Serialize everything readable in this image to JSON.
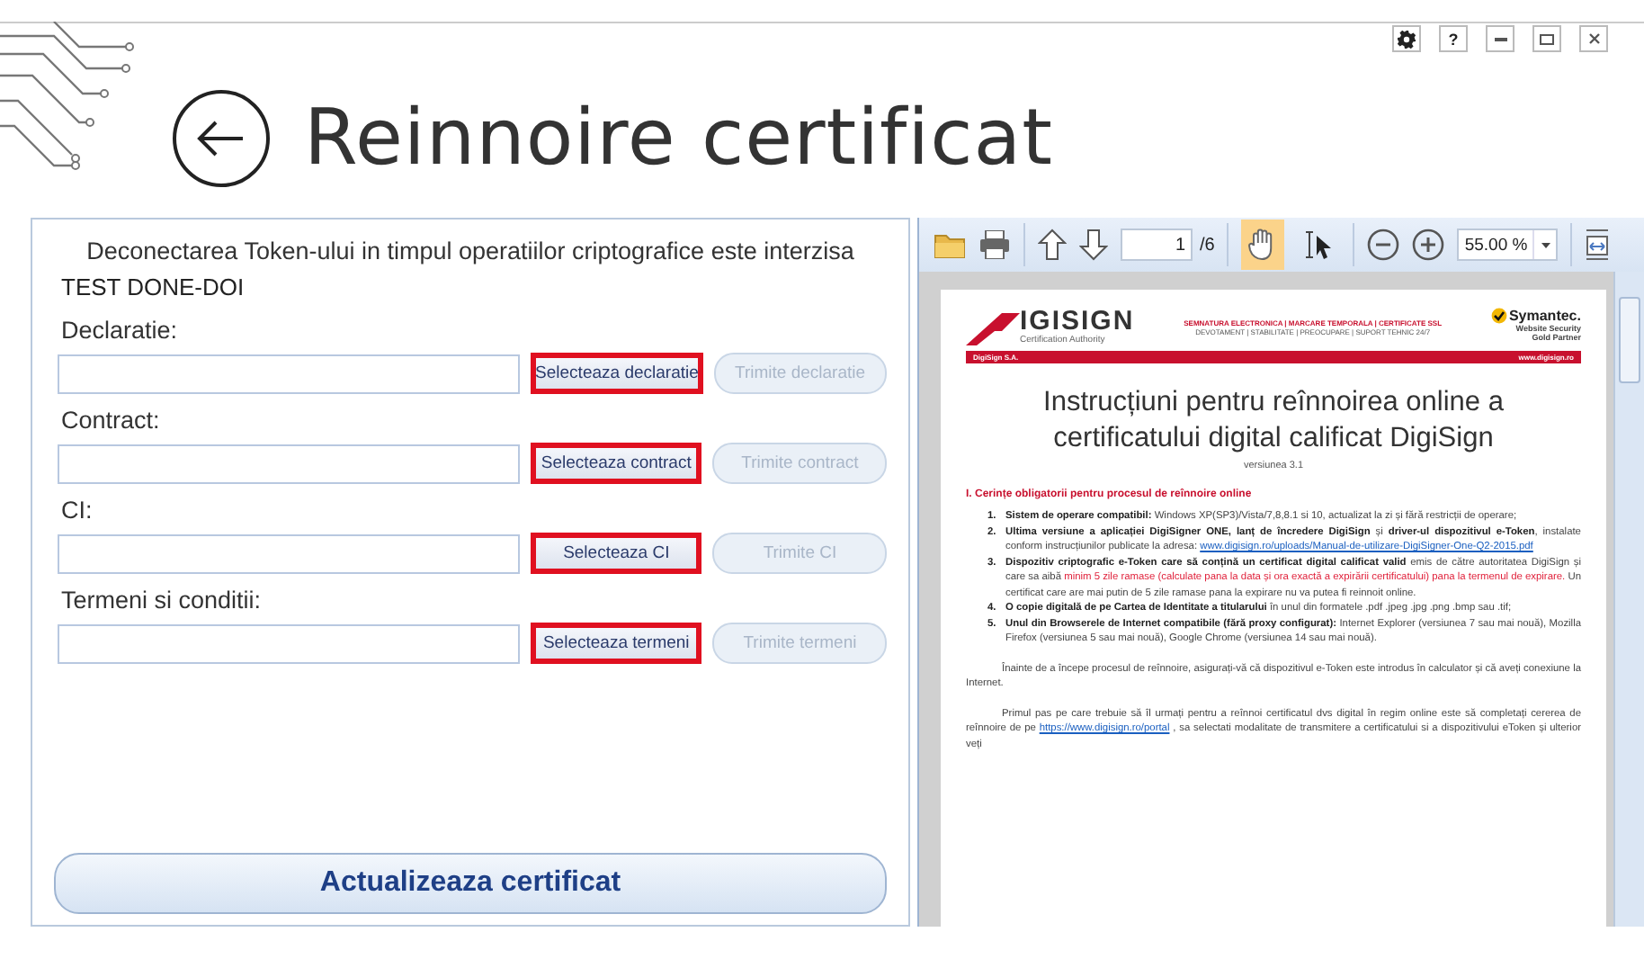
{
  "window": {
    "title": "Reinnoire certificat",
    "controls": [
      {
        "kind": "settings"
      },
      {
        "kind": "help",
        "label": "?"
      },
      {
        "kind": "minimize"
      },
      {
        "kind": "maximize"
      },
      {
        "kind": "close"
      }
    ]
  },
  "form": {
    "warning": "Deconectarea Token-ului in timpul operatiilor criptografice este interzisa",
    "user": "TEST DONE-DOI",
    "rows": [
      {
        "label": "Declaratie:",
        "select": "Selecteaza declaratie",
        "send": "Trimite declaratie",
        "highlighted": true,
        "send_disabled": true
      },
      {
        "label": "Contract:",
        "select": "Selecteaza contract",
        "send": "Trimite contract",
        "highlighted": true,
        "send_disabled": true
      },
      {
        "label": "CI:",
        "select": "Selecteaza CI",
        "send": "Trimite CI",
        "highlighted": true,
        "send_disabled": true
      },
      {
        "label": "Termeni si conditii:",
        "select": "Selecteaza termeni",
        "send": "Trimite termeni",
        "highlighted": true,
        "send_disabled": true
      }
    ],
    "submit": "Actualizeaza certificat"
  },
  "viewer": {
    "toolbar": [
      {
        "kind": "open"
      },
      {
        "kind": "print"
      },
      {
        "kind": "sep"
      },
      {
        "kind": "prev"
      },
      {
        "kind": "next"
      },
      {
        "kind": "page",
        "value": "1",
        "total": "/6"
      },
      {
        "kind": "sep"
      },
      {
        "kind": "hand",
        "selected": true
      },
      {
        "kind": "select",
        "selected": false
      },
      {
        "kind": "sep"
      },
      {
        "kind": "zoomout"
      },
      {
        "kind": "zoomin"
      },
      {
        "kind": "zoom",
        "value": "55.00 %"
      },
      {
        "kind": "sep"
      },
      {
        "kind": "fit"
      }
    ],
    "document": {
      "logo": "IGISIGN",
      "logo_sub": "Certification Authority",
      "tagline": "SEMNATURA ELECTRONICA | MARCARE TEMPORALA | CERTIFICATE SSL",
      "values": "DEVOTAMENT | STABILITATE | PREOCUPARE | SUPORT TEHNIC 24/7",
      "partner": "Symantec.",
      "partner_sub": [
        "Website Security",
        "Gold Partner"
      ],
      "bar_left": "DigiSign S.A.",
      "bar_right": "www.digisign.ro",
      "title": "Instrucțiuni pentru reînnoirea online a certificatului digital calificat DigiSign",
      "version": "versiunea 3.1",
      "heading": "I. Cerințe obligatorii pentru procesul de reînnoire online",
      "items": [
        {
          "number": "1.",
          "segments": [
            {
              "kind": "bold",
              "text": "Sistem de operare compatibil:"
            },
            {
              "kind": "plain",
              "text": " Windows XP(SP3)/Vista/7,8,8.1 si 10, actualizat la zi și fără restricții de operare;"
            }
          ]
        },
        {
          "number": "2.",
          "segments": [
            {
              "kind": "bold",
              "text": "Ultima versiune a aplicației DigiSigner ONE, lanț de încredere DigiSign"
            },
            {
              "kind": "plain",
              "text": " și "
            },
            {
              "kind": "bold",
              "text": "driver-ul dispozitivul e-Token"
            },
            {
              "kind": "plain",
              "text": ", instalate conform instrucțiunilor publicate la adresa: "
            },
            {
              "kind": "link",
              "text": "www.digisign.ro/uploads/Manual-de-utilizare-DigiSigner-One-Q2-2015.pdf"
            }
          ]
        },
        {
          "number": "3.",
          "segments": [
            {
              "kind": "bold",
              "text": "Dispozitiv criptografic e-Token care să conțină un certificat digital calificat valid"
            },
            {
              "kind": "plain",
              "text": " emis de către autoritatea DigiSign și care sa aibă "
            },
            {
              "kind": "red",
              "text": "minim 5 zile ramase (calculate pana la data și ora exactă a expirării certificatului) pana la termenul de expirare."
            },
            {
              "kind": "plain",
              "text": " Un certificat care are mai putin de 5 zile ramase pana la expirare nu va putea fi reinnoit online."
            }
          ]
        },
        {
          "number": "4.",
          "segments": [
            {
              "kind": "bold",
              "text": "O copie digitală de pe Cartea de Identitate a titularului"
            },
            {
              "kind": "plain",
              "text": " în unul din formatele .pdf .jpeg .jpg .png .bmp sau .tif;"
            }
          ]
        },
        {
          "number": "5.",
          "segments": [
            {
              "kind": "bold",
              "text": "Unul din Browserele de Internet compatibile (fără proxy configurat):"
            },
            {
              "kind": "plain",
              "text": " Internet Explorer (versiunea 7 sau mai nouă), Mozilla Firefox (versiunea 5 sau mai nouă), Google Chrome (versiunea 14 sau mai nouă)."
            }
          ]
        }
      ],
      "paragraphs": [
        [
          {
            "kind": "plain",
            "text": "Înainte de a începe procesul de reînnoire, asigurați-vă că dispozitivul e-Token este introdus în calculator și că aveți conexiune la Internet."
          }
        ],
        [
          {
            "kind": "plain",
            "text": "Primul pas pe care trebuie să îl urmați pentru a reînnoi certificatul dvs digital în regim online este să completați cererea de reînnoire de pe "
          },
          {
            "kind": "link",
            "text": "https://www.digisign.ro/portal"
          },
          {
            "kind": "plain",
            "text": " , sa selectati modalitate de transmitere a certificatului si a dispozitivului eToken și ulterior veți"
          }
        ]
      ]
    }
  }
}
